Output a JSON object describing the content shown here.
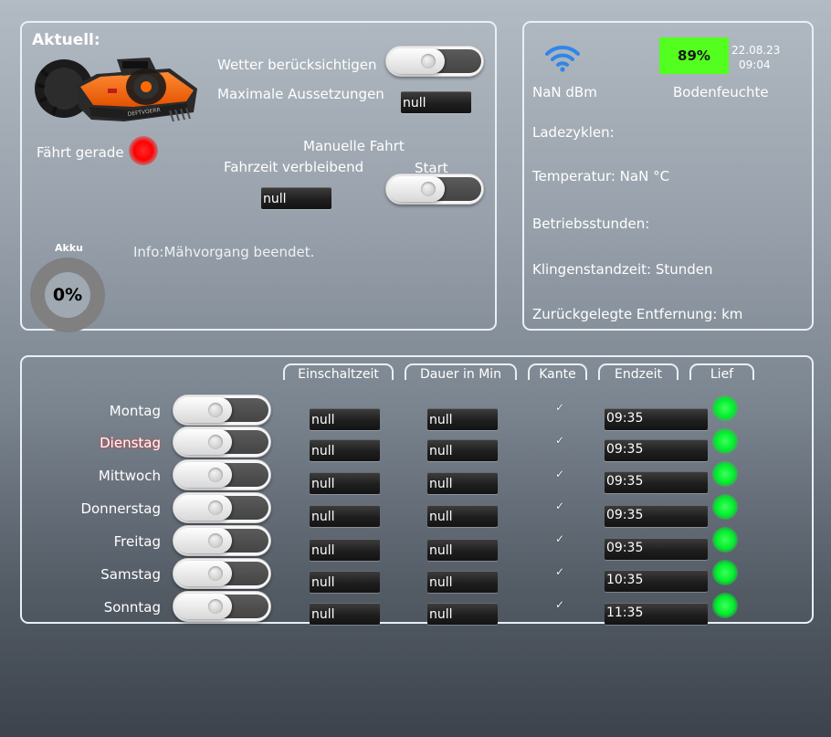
{
  "current": {
    "title": "Aktuell:",
    "weather_label": "Wetter berücksichtigen",
    "max_pause_label": "Maximale Aussetzungen",
    "max_pause_value": "null",
    "status_text": "Fährt gerade",
    "manual_label": "Manuelle Fahrt",
    "remaining_label": "Fahrzeit verbleibend",
    "remaining_value": "null",
    "start_label": "Start",
    "battery_label": "Akku",
    "battery_value": "0%",
    "battery_level": 0,
    "info_text": "Info:Mähvorgang beendet.",
    "mower_brand_text": "DEFTVOERR"
  },
  "status": {
    "wifi_icon": "wifi-icon",
    "signal_text": "NaN dBm",
    "moisture_value": "89%",
    "moisture_label": "Bodenfeuchte",
    "date": "22.08.23",
    "time": "09:04",
    "charge_cycles": "Ladezyklen:",
    "temperature": "Temperatur: NaN °C",
    "operating_hours": "Betriebsstunden:",
    "blade_time": "Klingenstandzeit: Stunden",
    "distance": "Zurückgelegte Entfernung: km",
    "colors": {
      "moisture_bg": "#53ff1f",
      "wifi": "#2f86e8"
    }
  },
  "schedule": {
    "headers": {
      "start_time": "Einschaltzeit",
      "duration": "Dauer in Min",
      "edge": "Kante",
      "end_time": "Endzeit",
      "running": "Lief"
    },
    "rows": [
      {
        "day": "Montag",
        "start": "null",
        "duration": "null",
        "edge": "✓",
        "end": "09:35"
      },
      {
        "day": "Dienstag",
        "start": "null",
        "duration": "null",
        "edge": "✓",
        "end": "09:35"
      },
      {
        "day": "Mittwoch",
        "start": "null",
        "duration": "null",
        "edge": "✓",
        "end": "09:35"
      },
      {
        "day": "Donnerstag",
        "start": "null",
        "duration": "null",
        "edge": "✓",
        "end": "09:35"
      },
      {
        "day": "Freitag",
        "start": "null",
        "duration": "null",
        "edge": "✓",
        "end": "09:35"
      },
      {
        "day": "Samstag",
        "start": "null",
        "duration": "null",
        "edge": "✓",
        "end": "10:35"
      },
      {
        "day": "Sonntag",
        "start": "null",
        "duration": "null",
        "edge": "✓",
        "end": "11:35"
      }
    ]
  }
}
